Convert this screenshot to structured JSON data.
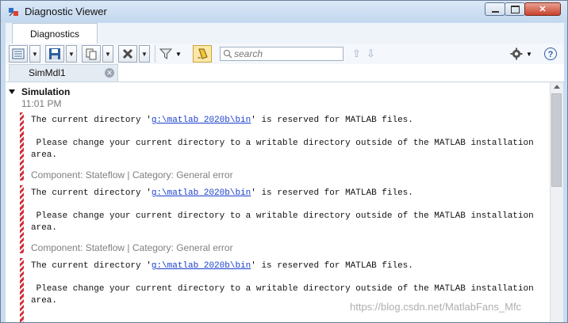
{
  "window": {
    "title": "Diagnostic Viewer"
  },
  "tabs": {
    "main": "Diagnostics"
  },
  "search": {
    "placeholder": "search"
  },
  "model_tab": {
    "label": "SimMdl1"
  },
  "group": {
    "title": "Simulation",
    "time": "11:01 PM"
  },
  "messages": [
    {
      "line1_pre": "The current directory '",
      "link": "g:\\matlab 2020b\\bin",
      "line1_post": "' is reserved for MATLAB files.",
      "line2": " Please change your current directory to a writable directory outside of the MATLAB installation",
      "line3": "area.",
      "meta": "Component: Stateflow | Category: General error"
    },
    {
      "line1_pre": "The current directory '",
      "link": "g:\\matlab 2020b\\bin",
      "line1_post": "' is reserved for MATLAB files.",
      "line2": " Please change your current directory to a writable directory outside of the MATLAB installation",
      "line3": "area.",
      "meta": "Component: Stateflow | Category: General error"
    },
    {
      "line1_pre": "The current directory '",
      "link": "g:\\matlab 2020b\\bin",
      "line1_post": "' is reserved for MATLAB files.",
      "line2": " Please change your current directory to a writable directory outside of the MATLAB installation",
      "line3": "area."
    }
  ],
  "watermark": "https://blog.csdn.net/MatlabFans_Mfc",
  "icons": {
    "app": "simulink-icon",
    "minimize": "minimize-icon",
    "maximize": "maximize-icon",
    "close": "close-icon",
    "report": "report-icon",
    "save": "save-icon",
    "copy": "copy-icon",
    "clear": "clear-icon",
    "filter": "filter-icon",
    "highlight": "highlight-icon",
    "search": "search-icon",
    "prev": "arrow-up-icon",
    "next": "arrow-down-icon",
    "settings": "gear-icon",
    "help": "help-icon"
  },
  "colors": {
    "error_stripe": "#d2303a",
    "link": "#1a3fcc",
    "meta_text": "#808080"
  }
}
